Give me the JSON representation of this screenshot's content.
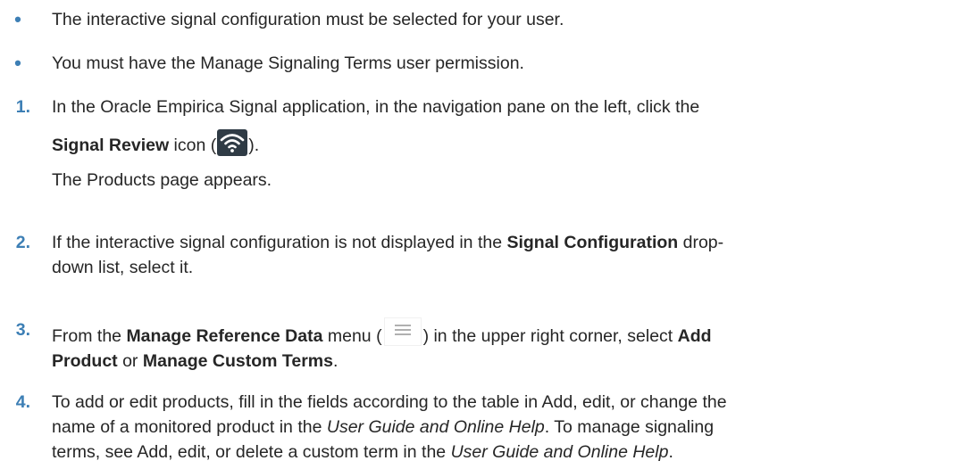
{
  "bullets": [
    "The interactive signal configuration must be selected for your user.",
    "You must have the Manage Signaling Terms user permission."
  ],
  "bullet_marker": "•",
  "colors": {
    "accent": "#3d7fb5",
    "text": "#262626",
    "icon_bg": "#2f3b45"
  },
  "icons": {
    "signal_review": "wifi-icon",
    "manage_reference_data": "hamburger-menu-icon"
  },
  "steps": [
    {
      "num": "1.",
      "t1": "In the Oracle Empirica Signal application, in the navigation pane on the left, click the",
      "b1": "Signal Review",
      "t2": " icon (",
      "t3": ").",
      "result": "The Products page appears."
    },
    {
      "num": "2.",
      "t1": "If the interactive signal configuration is not displayed in the ",
      "b1": "Signal Configuration",
      "t2": " drop-",
      "t3": "down list, select it."
    },
    {
      "num": "3.",
      "t1": "From the ",
      "b1": "Manage Reference Data",
      "t2": " menu (",
      "t3": ") in the upper right corner, select ",
      "b2": "Add",
      "b3": "Product",
      "t4": " or ",
      "b4": "Manage Custom Terms",
      "t5": "."
    },
    {
      "num": "4.",
      "t1": "To add or edit products, fill in the fields according to the table in Add, edit, or change the",
      "t2": "name of a monitored product in the ",
      "i1": "User Guide and Online Help",
      "t3": ". To manage signaling",
      "t4": "terms, see Add, edit, or delete a custom term in the ",
      "i2": "User Guide and Online Help",
      "t5": "."
    }
  ]
}
